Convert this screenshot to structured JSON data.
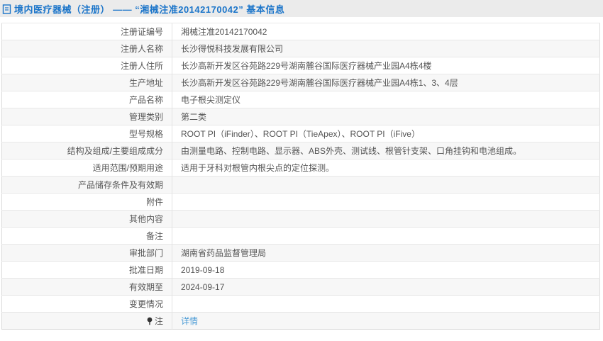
{
  "header": {
    "icon": "document-icon",
    "title": "境内医疗器械（注册） —— “湘械注准20142170042” 基本信息"
  },
  "colors": {
    "header_bar_bg": "#ebebeb",
    "title_blue": "#1a74c9",
    "link_blue": "#4a9bd5",
    "alt_row_bg": "#f7f7f7",
    "border": "#e2e2e2",
    "text": "#555555"
  },
  "table": {
    "rows": [
      {
        "label": "注册证编号",
        "value": "湘械注准20142170042"
      },
      {
        "label": "注册人名称",
        "value": "长沙得悦科技发展有限公司"
      },
      {
        "label": "注册人住所",
        "value": "长沙高新开发区谷苑路229号湖南麓谷国际医疗器械产业园A4栋4楼"
      },
      {
        "label": "生产地址",
        "value": "长沙高新开发区谷苑路229号湖南麓谷国际医疗器械产业园A4栋1、3、4层"
      },
      {
        "label": "产品名称",
        "value": "电子根尖测定仪"
      },
      {
        "label": "管理类别",
        "value": "第二类"
      },
      {
        "label": "型号规格",
        "value": "ROOT PI（iFinder）、ROOT PI（TieApex）、ROOT PI（iFive）"
      },
      {
        "label": "结构及组成/主要组成成分",
        "value": "由测量电路、控制电路、显示器、ABS外壳、测试线、根管针支架、口角挂钩和电池组成。"
      },
      {
        "label": "适用范围/预期用途",
        "value": "适用于牙科对根管内根尖点的定位探测。"
      },
      {
        "label": "产品储存条件及有效期",
        "value": ""
      },
      {
        "label": "附件",
        "value": ""
      },
      {
        "label": "其他内容",
        "value": ""
      },
      {
        "label": "备注",
        "value": ""
      },
      {
        "label": "审批部门",
        "value": "湖南省药品监督管理局"
      },
      {
        "label": "批准日期",
        "value": "2019-09-18"
      },
      {
        "label": "有效期至",
        "value": "2024-09-17"
      },
      {
        "label": "变更情况",
        "value": ""
      },
      {
        "label": "注",
        "value": "详情"
      }
    ]
  }
}
